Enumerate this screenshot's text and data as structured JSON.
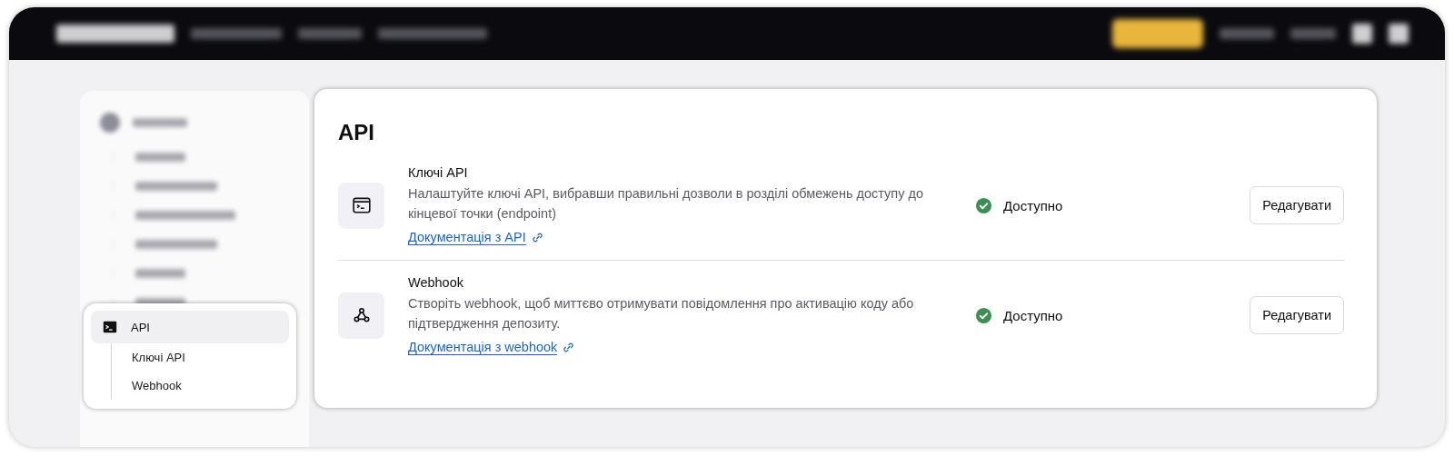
{
  "sidebar": {
    "items": [
      {
        "label": "API",
        "selected": true,
        "children": [
          {
            "label": "Ключі API",
            "selected": false
          },
          {
            "label": "Webhook",
            "selected": false
          }
        ]
      }
    ]
  },
  "page": {
    "title": "API",
    "sections": [
      {
        "kind": "keys",
        "title": "Ключі API",
        "description": "Налаштуйте ключі API, вибравши правильні дозволи в розділі обмежень доступу до кінцевої точки (endpoint)",
        "link": "Документація з API",
        "status": {
          "label": "Доступно",
          "available": true
        },
        "button": "Редагувати"
      },
      {
        "kind": "webhook",
        "title": "Webhook",
        "description": "Створіть webhook, щоб миттєво отримувати повідомлення про активацію коду або підтвердження депозиту.",
        "link": "Документація з webhook",
        "status": {
          "label": "Доступно",
          "available": true
        },
        "button": "Редагувати"
      }
    ]
  }
}
